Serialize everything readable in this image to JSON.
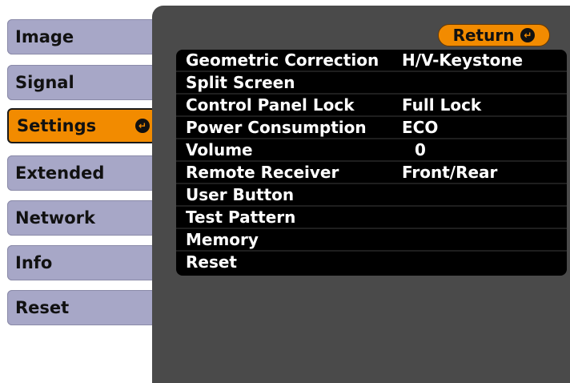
{
  "sidebar": {
    "items": [
      {
        "label": "Image"
      },
      {
        "label": "Signal"
      },
      {
        "label": "Settings"
      },
      {
        "label": "Extended"
      },
      {
        "label": "Network"
      },
      {
        "label": "Info"
      },
      {
        "label": "Reset"
      }
    ],
    "active_index": 2
  },
  "return_button": {
    "label": "Return"
  },
  "settings": [
    {
      "label": "Geometric Correction",
      "value": "H/V-Keystone"
    },
    {
      "label": "Split Screen",
      "value": ""
    },
    {
      "label": "Control Panel Lock",
      "value": "Full Lock"
    },
    {
      "label": "Power Consumption",
      "value": "ECO"
    },
    {
      "label": "Volume",
      "value": "0"
    },
    {
      "label": "Remote Receiver",
      "value": "Front/Rear"
    },
    {
      "label": "User Button",
      "value": ""
    },
    {
      "label": "Test Pattern",
      "value": ""
    },
    {
      "label": "Memory",
      "value": ""
    },
    {
      "label": "Reset",
      "value": ""
    }
  ],
  "icons": {
    "enter": "enter-icon"
  },
  "colors": {
    "accent": "#f28b00",
    "tab": "#a7a7c7",
    "panel": "#4a4a4a",
    "list": "#000000"
  }
}
